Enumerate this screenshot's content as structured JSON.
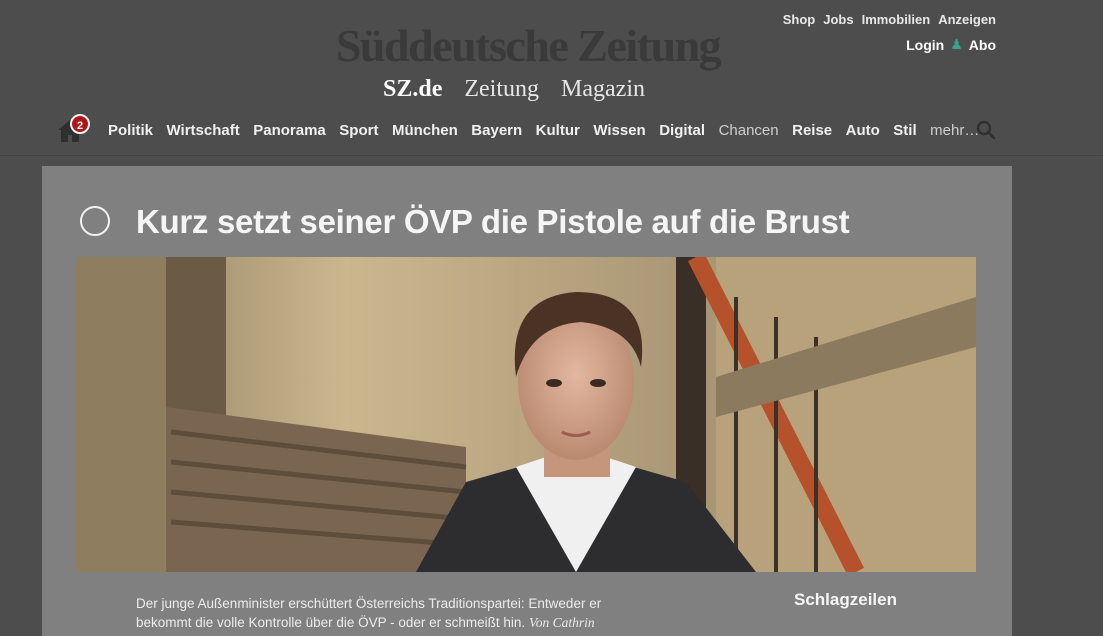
{
  "header": {
    "logo": "Süddeutsche Zeitung",
    "subnav": [
      "SZ.de",
      "Zeitung",
      "Magazin"
    ],
    "toplinks": [
      "Shop",
      "Jobs",
      "Immobilien",
      "Anzeigen"
    ],
    "login": "Login",
    "abo": "Abo"
  },
  "nav": {
    "badge_count": "2",
    "items": [
      "Politik",
      "Wirtschaft",
      "Panorama",
      "Sport",
      "München",
      "Bayern",
      "Kultur",
      "Wissen",
      "Digital",
      "Chancen",
      "Reise",
      "Auto",
      "Stil",
      "mehr…"
    ]
  },
  "article": {
    "headline": "Kurz setzt seiner ÖVP die Pistole auf die Brust",
    "teaser_text": "Der junge Außenminister erschüttert Österreichs Traditionspartei: Entweder er bekommt die volle Kontrolle über die ÖVP - oder er schmeißt hin.",
    "byline": "Von Cathrin"
  },
  "sidebar": {
    "title": "Schlagzeilen"
  },
  "colors": {
    "badge": "#b0151b",
    "user_icon": "#3aa08f"
  }
}
